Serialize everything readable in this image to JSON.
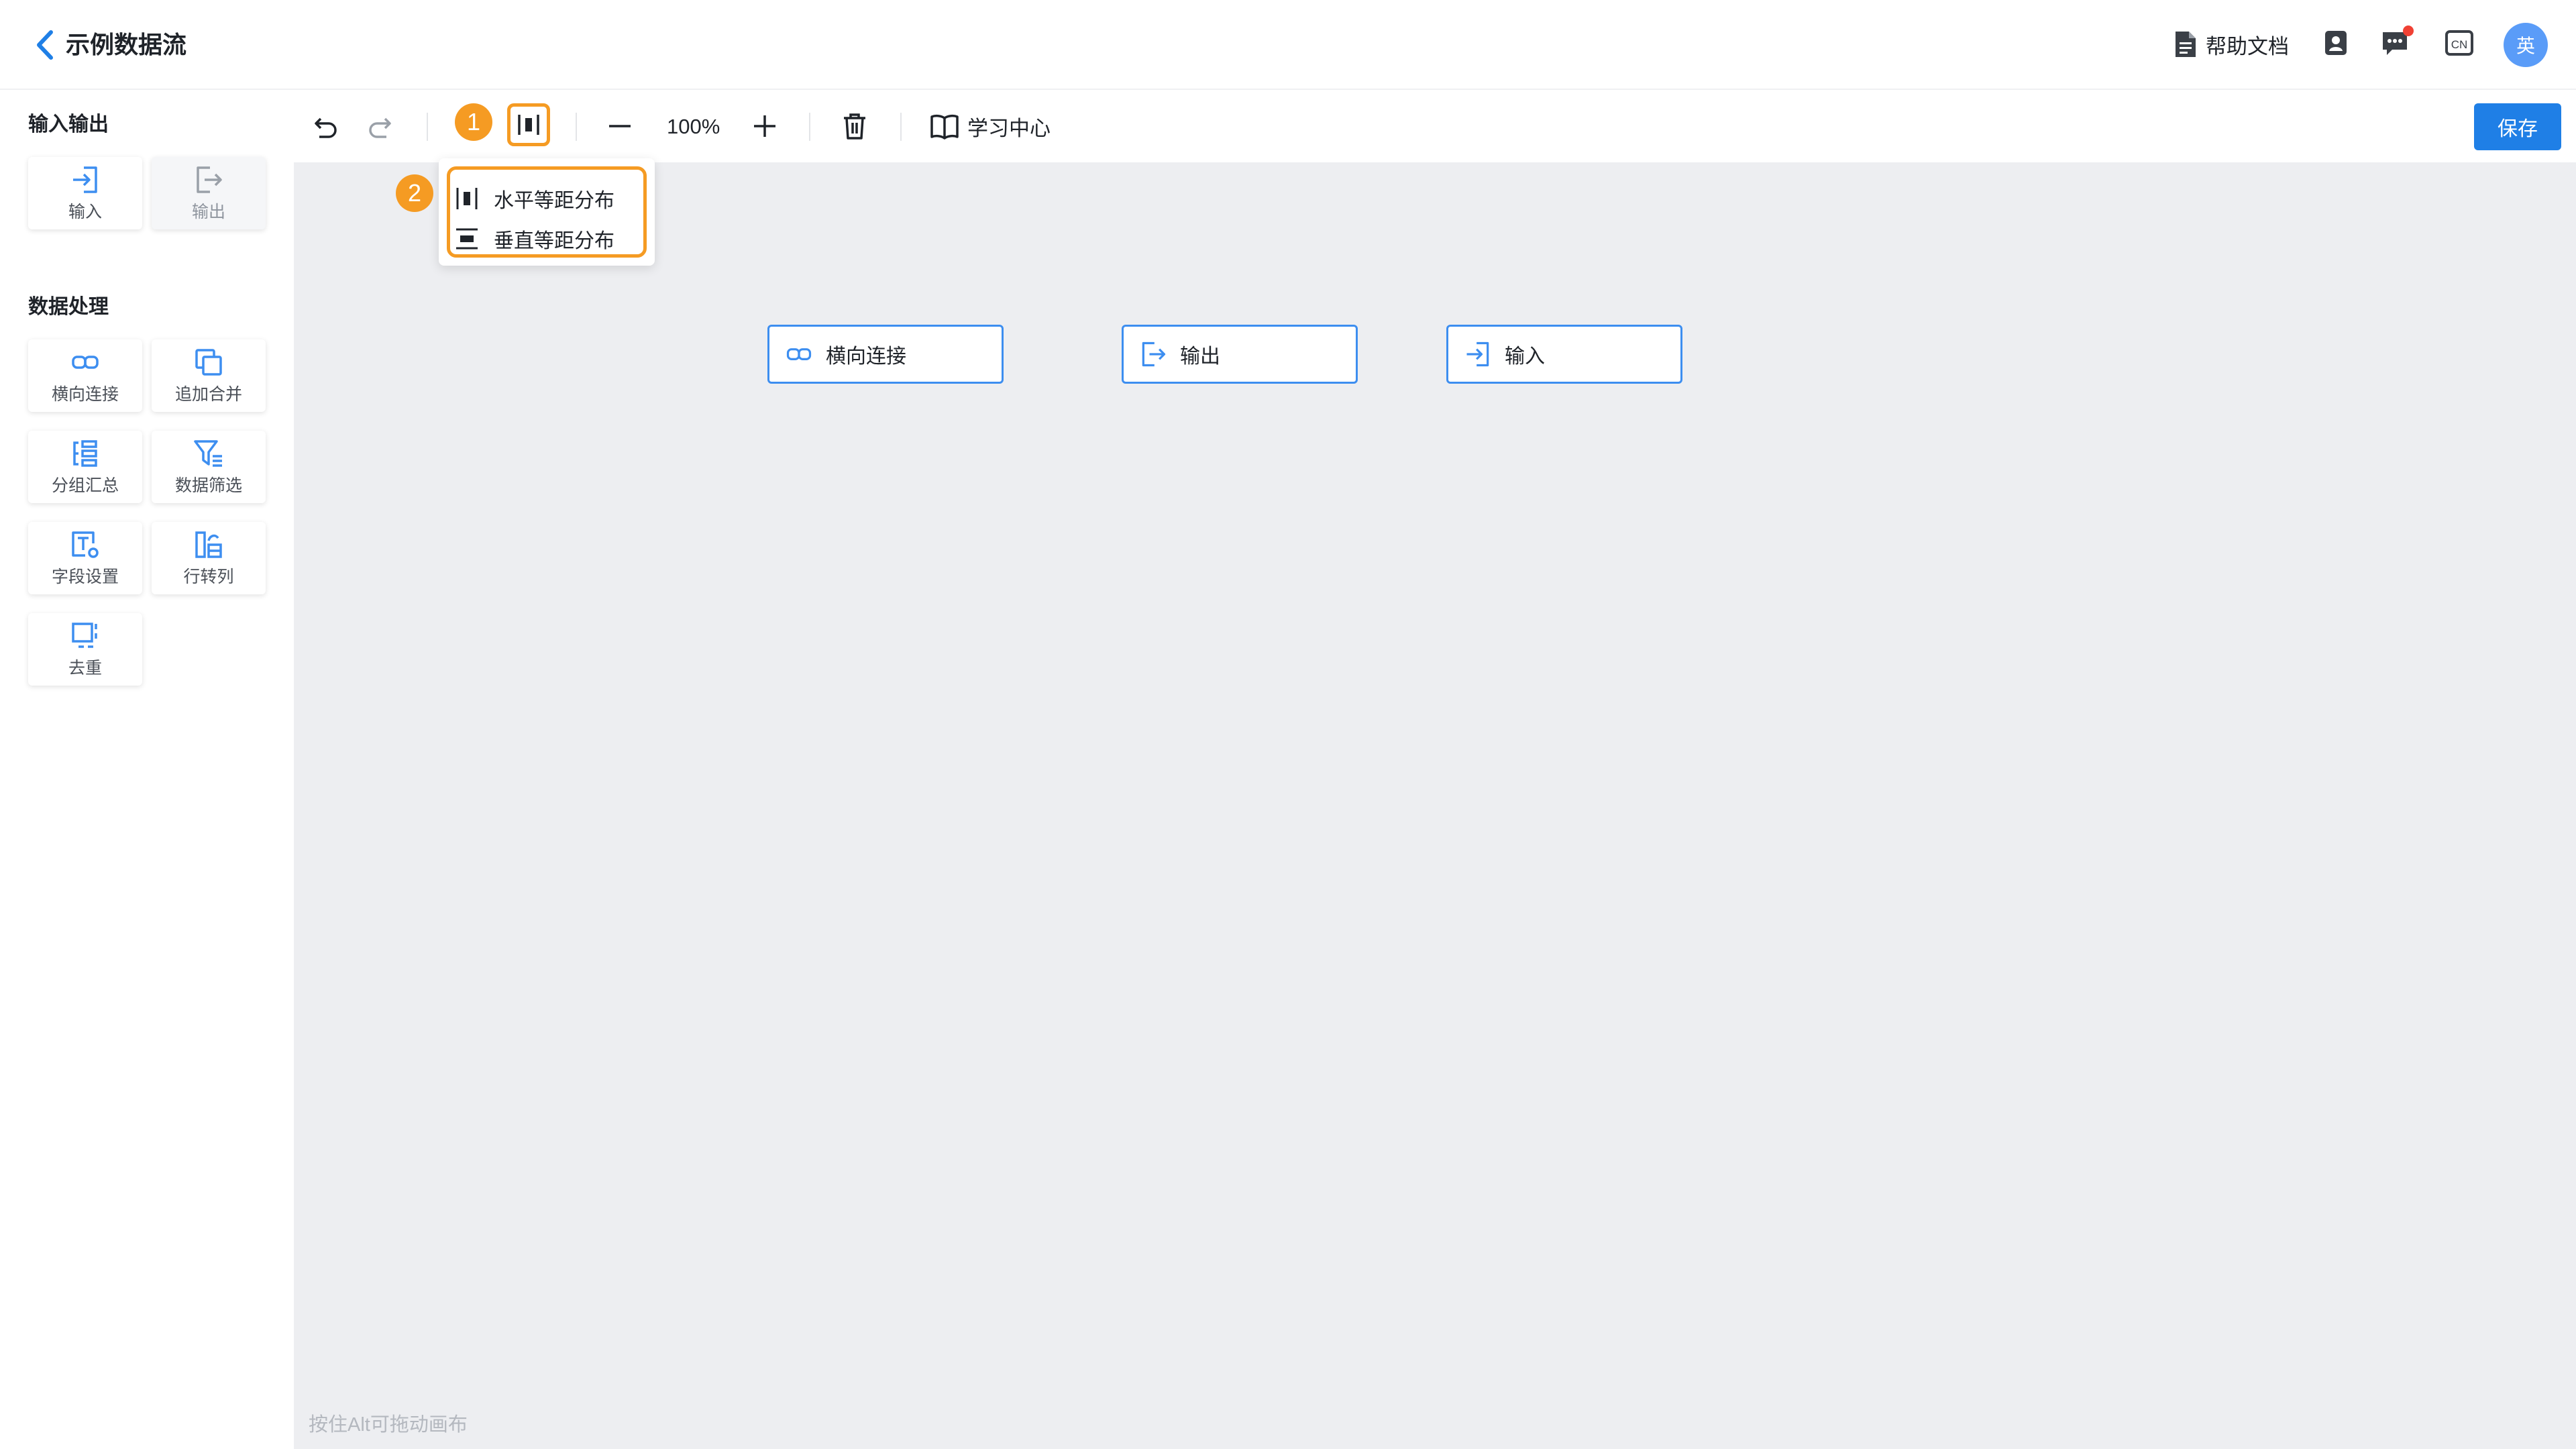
{
  "header": {
    "title": "示例数据流",
    "help_label": "帮助文档",
    "lang_badge": "CN",
    "avatar_text": "英",
    "has_notification": true
  },
  "sidebar": {
    "section_io": "输入输出",
    "io_items": [
      {
        "label": "输入",
        "icon": "input-icon",
        "disabled": false
      },
      {
        "label": "输出",
        "icon": "output-icon",
        "disabled": true
      }
    ],
    "section_processing": "数据处理",
    "processing_items": [
      {
        "label": "横向连接",
        "icon": "join-icon"
      },
      {
        "label": "追加合并",
        "icon": "append-icon"
      },
      {
        "label": "分组汇总",
        "icon": "group-icon"
      },
      {
        "label": "数据筛选",
        "icon": "filter-icon"
      },
      {
        "label": "字段设置",
        "icon": "field-settings-icon"
      },
      {
        "label": "行转列",
        "icon": "pivot-icon"
      },
      {
        "label": "去重",
        "icon": "dedupe-icon"
      }
    ]
  },
  "toolbar": {
    "zoom": "100%",
    "learn_label": "学习中心",
    "save_label": "保存"
  },
  "annotations": {
    "step1": "1",
    "step2": "2"
  },
  "align_menu": {
    "items": [
      {
        "label": "水平等距分布",
        "icon": "distribute-horizontal-icon"
      },
      {
        "label": "垂直等距分布",
        "icon": "distribute-vertical-icon"
      }
    ]
  },
  "canvas": {
    "nodes": [
      {
        "label": "横向连接",
        "icon": "join-icon"
      },
      {
        "label": "输出",
        "icon": "output-icon"
      },
      {
        "label": "输入",
        "icon": "input-icon"
      }
    ],
    "hint": "按住Alt可拖动画布"
  },
  "colors": {
    "accent": "#1f7fe6",
    "node_border": "#3d8ef0",
    "highlight": "#f59b23",
    "canvas_bg": "#edeef1"
  }
}
